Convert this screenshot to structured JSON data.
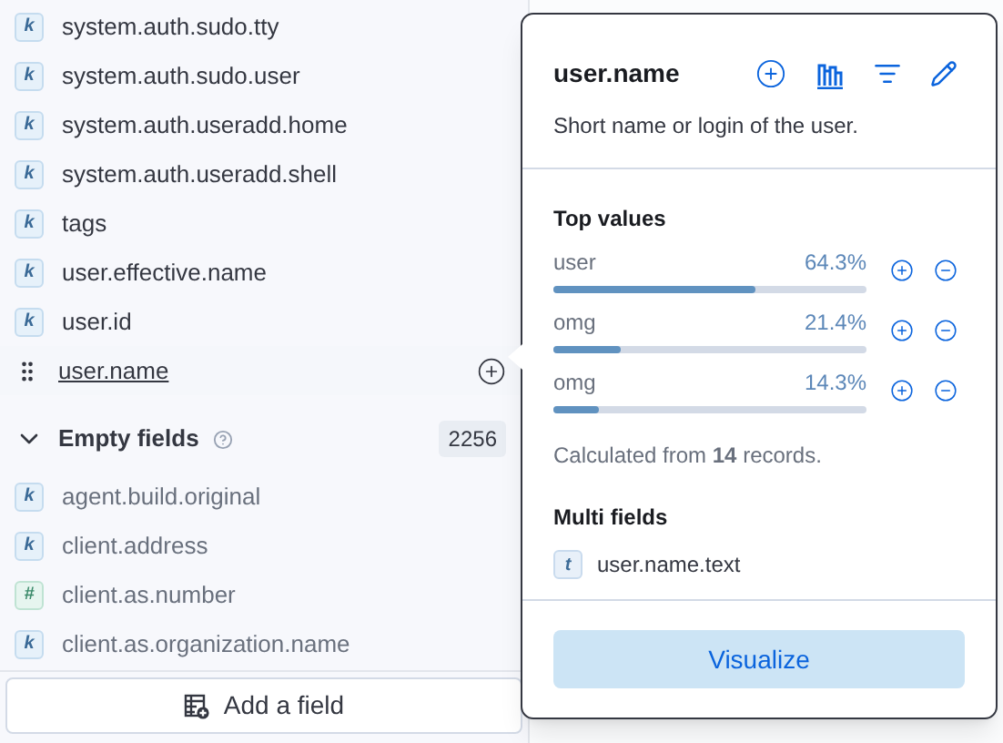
{
  "available_fields": [
    {
      "name": "system.auth.sudo.tty",
      "kind": "keyword",
      "badge": "k",
      "selected": false
    },
    {
      "name": "system.auth.sudo.user",
      "kind": "keyword",
      "badge": "k",
      "selected": false
    },
    {
      "name": "system.auth.useradd.home",
      "kind": "keyword",
      "badge": "k",
      "selected": false
    },
    {
      "name": "system.auth.useradd.shell",
      "kind": "keyword",
      "badge": "k",
      "selected": false
    },
    {
      "name": "tags",
      "kind": "keyword",
      "badge": "k",
      "selected": false
    },
    {
      "name": "user.effective.name",
      "kind": "keyword",
      "badge": "k",
      "selected": false
    },
    {
      "name": "user.id",
      "kind": "keyword",
      "badge": "k",
      "selected": false
    },
    {
      "name": "user.name",
      "selected": true
    }
  ],
  "empty_fields": {
    "title": "Empty fields",
    "count": "2256",
    "expanded": true,
    "fields": [
      {
        "name": "agent.build.original",
        "kind": "keyword",
        "badge": "k"
      },
      {
        "name": "client.address",
        "kind": "keyword",
        "badge": "k"
      },
      {
        "name": "client.as.number",
        "kind": "number",
        "badge": "#"
      },
      {
        "name": "client.as.organization.name",
        "kind": "keyword",
        "badge": "k"
      }
    ]
  },
  "add_field_button": "Add a field",
  "popover": {
    "title": "user.name",
    "description": "Short name or login of the user.",
    "top_values_title": "Top values",
    "top_values": [
      {
        "value": "user",
        "percent": "64.3%",
        "level": 0.643
      },
      {
        "value": "omg",
        "percent": "21.4%",
        "level": 0.214
      },
      {
        "value": "omg",
        "percent": "14.3%",
        "level": 0.143
      }
    ],
    "calculated_note": "Calculated from **14** records.",
    "multi_fields_title": "Multi fields",
    "multi_fields": [
      {
        "name": "user.name.text",
        "kind": "text",
        "badge": "t"
      }
    ],
    "visualize_button": "Visualize"
  }
}
